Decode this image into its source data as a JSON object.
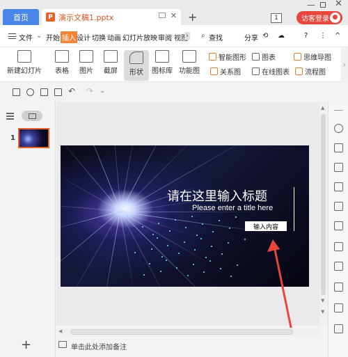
{
  "tabbar": {
    "home_label": "首页",
    "doc_title": "演示文稿1.pptx",
    "doc_icon_letter": "P",
    "new_tab": "+",
    "badge_count": "1",
    "login_label": "访客登录"
  },
  "menubar": {
    "file": "文件",
    "items": [
      "开始",
      "插入",
      "设计",
      "切换",
      "动画",
      "幻灯片放映",
      "审阅",
      "视图"
    ],
    "active": "插入",
    "search": "查找",
    "share": "分享",
    "help": "?",
    "more": "⋮",
    "collapse": "^"
  },
  "ribbon": {
    "new_slide": "新建幻灯片",
    "table": "表格",
    "picture": "图片",
    "screenshot": "截屏",
    "shape": "形状",
    "icon_lib": "图标库",
    "function_chart": "功能图",
    "smart_graphic": "智能图形",
    "chart": "图表",
    "mind_map": "思维导图",
    "relation": "关系图",
    "online_chart": "在线图表",
    "flowchart": "流程图"
  },
  "slide": {
    "number": "1",
    "title": "请在这里输入标题",
    "subtitle": "Please enter a title here",
    "content_box": "输入内容"
  },
  "notes": {
    "placeholder": "单击此处添加备注"
  },
  "left_panel": {
    "add_slide": "+"
  },
  "colors": {
    "accent": "#f2843a",
    "home_tab": "#4a86e8",
    "login": "#e8453c",
    "arrow": "#e8453c"
  }
}
